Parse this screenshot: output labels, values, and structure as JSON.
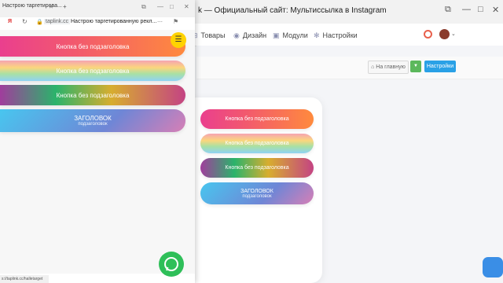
{
  "background_window": {
    "tab_title": "k — Официальный сайт: Мультиссылка в Instagram",
    "nav": [
      {
        "label": "Товары",
        "icon": "cart-icon"
      },
      {
        "label": "Дизайн",
        "icon": "palette-icon"
      },
      {
        "label": "Модули",
        "icon": "modules-icon"
      },
      {
        "label": "Настройки",
        "icon": "gear-icon"
      }
    ],
    "toolbar": {
      "home_button": "На главную",
      "settings_button": "Настройки"
    },
    "preview_buttons": [
      {
        "label": "Кнопка без подзаголовка"
      },
      {
        "label": "Кнопка без подзаголовка"
      },
      {
        "label": "Кнопка без подзаголовка"
      },
      {
        "label": "ЗАГОЛОВОК",
        "sublabel": "подзаголовок"
      }
    ]
  },
  "foreground_window": {
    "tab_title": "Настрою таргетирова...",
    "address_domain": "taplink.cc",
    "address_title": "Настрою таргетированную рекл...",
    "buttons": [
      {
        "label": "Кнопка без подзаголовка"
      },
      {
        "label": "Кнопка без подзаголовка"
      },
      {
        "label": "Кнопка без подзаголовка"
      },
      {
        "label": "ЗАГОЛОВОК",
        "sublabel": "подзаголовок"
      }
    ],
    "status_url": "s://taplink.cc/halletarget"
  },
  "colors": {
    "accent_blue": "#2aa1e6",
    "accent_green": "#5cb85c",
    "whatsapp": "#2fbf59",
    "menu_yellow": "#ffd200"
  }
}
